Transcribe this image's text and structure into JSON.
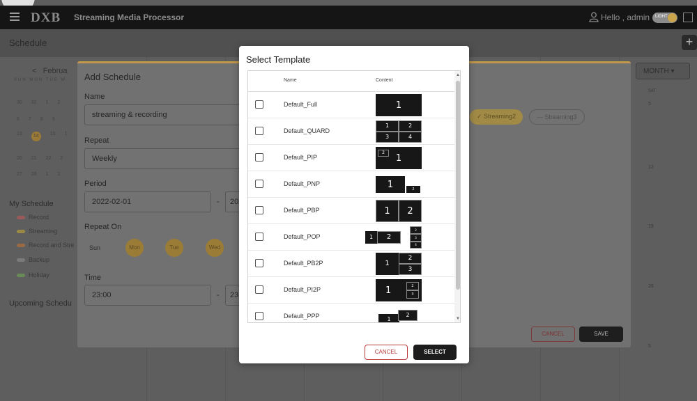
{
  "app": {
    "title": "Streaming Media Processor",
    "logo": "DXB",
    "greeting": "Hello , admin",
    "theme_toggle": "LIGHT"
  },
  "schedule": {
    "title": "Schedule",
    "month_label": "Februa",
    "view": "MONTH",
    "day_header": "SAT"
  },
  "calendar": {
    "weekdays": "SUN MON TUE W",
    "rows": [
      [
        "30",
        "31",
        "1",
        "2"
      ],
      [
        "6",
        "7",
        "8",
        "9"
      ],
      [
        "13",
        "14",
        "15",
        "1"
      ],
      [
        "20",
        "21",
        "22",
        "2"
      ],
      [
        "27",
        "28",
        "1",
        "2"
      ]
    ]
  },
  "sidebar": {
    "my_schedule": "My Schedule",
    "legend": [
      {
        "label": "Record",
        "color": "#9a5a5a"
      },
      {
        "label": "Streaming",
        "color": "#9a8a45"
      },
      {
        "label": "Record and Stre",
        "color": "#9a6a45"
      },
      {
        "label": "Backup",
        "color": "#7a7a7a"
      },
      {
        "label": "Holiday",
        "color": "#6a8a55"
      }
    ],
    "upcoming": "Upcoming Schedu"
  },
  "day_numbers": [
    "5",
    "12",
    "19",
    "26",
    "5"
  ],
  "add_schedule": {
    "title": "Add Schedule",
    "name_label": "Name",
    "name_value": "streaming & recording",
    "repeat_label": "Repeat",
    "repeat_value": "Weekly",
    "period_label": "Period",
    "period_start": "2022-02-01",
    "period_end": "202",
    "repeat_on_label": "Repeat On",
    "sun": "Sun",
    "mon": "Mon",
    "tue": "Tue",
    "wed": "Wed",
    "time_label": "Time",
    "time_start": "23:00",
    "time_end": "23:",
    "chip_streaming2": "✓ Streaming2",
    "chip_streaming3": "— Streaming3",
    "cancel": "CANCEL",
    "save": "SAVE"
  },
  "modal": {
    "title": "Select Template",
    "col_name": "Name",
    "col_content": "Content",
    "templates": [
      "Default_Full",
      "Default_QUARD",
      "Default_PIP",
      "Default_PNP",
      "Default_PBP",
      "Default_POP",
      "Default_PB2P",
      "Default_PI2P",
      "Default_PPP"
    ],
    "digits": {
      "one": "1",
      "two": "2",
      "three": "3",
      "four": "4"
    },
    "cancel": "CANCEL",
    "select": "SELECT"
  }
}
